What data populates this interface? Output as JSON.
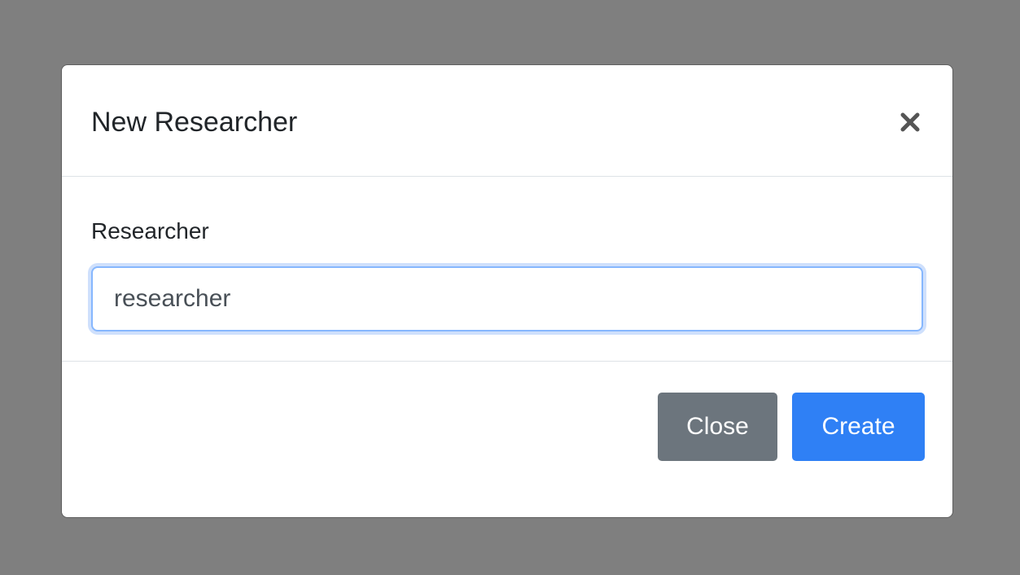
{
  "modal": {
    "title": "New Researcher",
    "close_icon": "close-icon"
  },
  "form": {
    "label": "Researcher",
    "input_value": "researcher"
  },
  "footer": {
    "close_label": "Close",
    "create_label": "Create"
  },
  "colors": {
    "backdrop": "#7f7f7f",
    "close_button": "#6c757d",
    "create_button": "#2f80f5",
    "input_focus_border": "#86b7fe"
  }
}
